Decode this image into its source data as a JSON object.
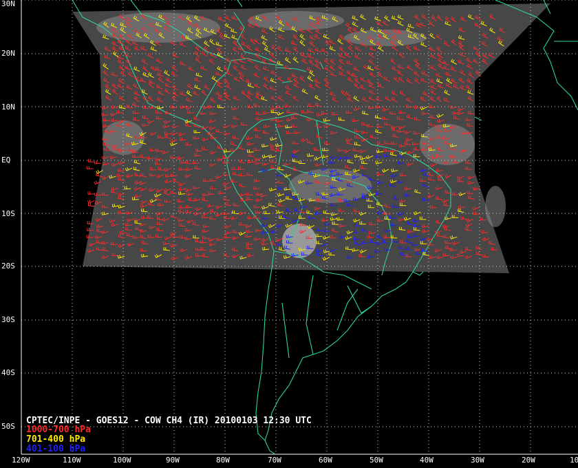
{
  "caption": {
    "title": "CPTEC/INPE - GOES12 - COW CH4 (IR) 20100103 12:30 UTC"
  },
  "legend": [
    {
      "label": "1000-700 hPa",
      "color": "#ff2a2a"
    },
    {
      "label": "701-400 hPa",
      "color": "#ffea00"
    },
    {
      "label": "401-100 hPa",
      "color": "#1f1fff"
    }
  ],
  "lat_labels": [
    "30N",
    "20N",
    "10N",
    "EQ",
    "10S",
    "20S",
    "30S",
    "40S",
    "50S"
  ],
  "lon_labels": [
    "120W",
    "110W",
    "100W",
    "90W",
    "80W",
    "70W",
    "60W",
    "50W",
    "40W",
    "30W",
    "20W",
    "10"
  ],
  "colors": {
    "background": "#000000",
    "coastline": "#2ed39a",
    "grid": "#d0d0d0",
    "imagery": "#4a4a4a"
  }
}
